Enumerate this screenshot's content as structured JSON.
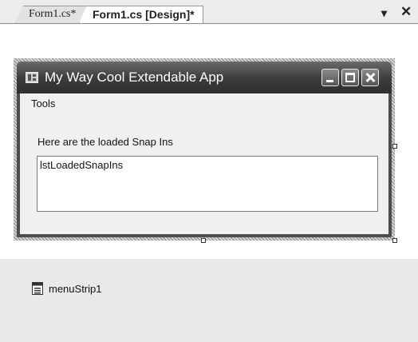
{
  "tabs": [
    {
      "label": "Form1.cs*",
      "active": false
    },
    {
      "label": "Form1.cs [Design]*",
      "active": true
    }
  ],
  "tabstrip": {
    "pin_glyph": "▾",
    "close_glyph": "✕"
  },
  "form": {
    "title": "My Way Cool Extendable App",
    "menu": {
      "items": [
        "Tools"
      ]
    },
    "label_text": "Here are the loaded Snap Ins",
    "listbox": {
      "name": "lstLoadedSnapIns"
    }
  },
  "tray": {
    "components": [
      {
        "name": "menuStrip1",
        "icon": "menustrip-icon"
      }
    ]
  }
}
